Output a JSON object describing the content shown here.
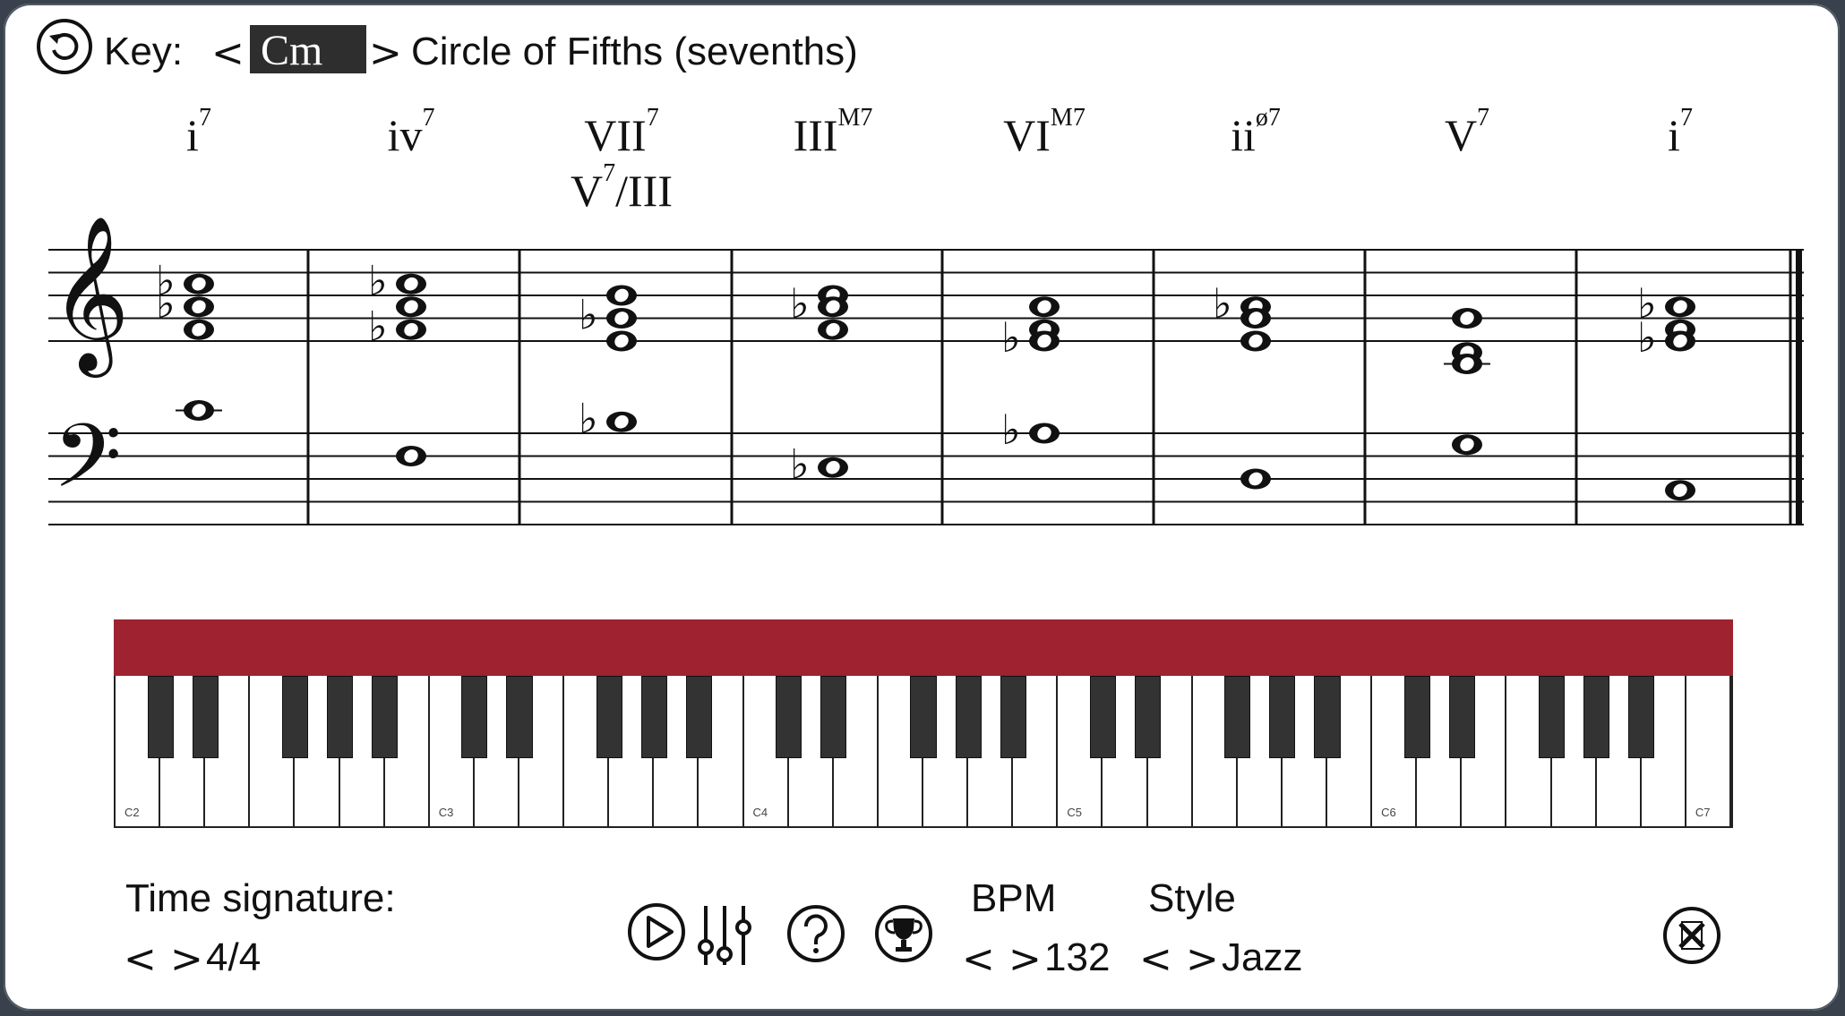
{
  "header": {
    "reset_icon": "reset-icon",
    "key_label": "Key:",
    "key_prev": "<",
    "key_value": "Cm",
    "key_next": ">",
    "progression_title": "Circle of Fifths (sevenths)"
  },
  "chords": [
    {
      "base": "i",
      "sup": "7",
      "alt_base": "",
      "alt_sup": "",
      "alt_tail": ""
    },
    {
      "base": "iv",
      "sup": "7",
      "alt_base": "",
      "alt_sup": "",
      "alt_tail": ""
    },
    {
      "base": "VII",
      "sup": "7",
      "alt_base": "V",
      "alt_sup": "7",
      "alt_tail": "/III"
    },
    {
      "base": "III",
      "sup": "M7",
      "alt_base": "",
      "alt_sup": "",
      "alt_tail": ""
    },
    {
      "base": "VI",
      "sup": "M7",
      "alt_base": "",
      "alt_sup": "",
      "alt_tail": ""
    },
    {
      "base": "ii",
      "sup": "ø7",
      "alt_base": "",
      "alt_sup": "",
      "alt_tail": ""
    },
    {
      "base": "V",
      "sup": "7",
      "alt_base": "",
      "alt_sup": "",
      "alt_tail": ""
    },
    {
      "base": "i",
      "sup": "7",
      "alt_base": "",
      "alt_sup": "",
      "alt_tail": ""
    }
  ],
  "notation": {
    "measures": [
      {
        "treble": [
          {
            "n": "C5",
            "acc": "♭"
          },
          {
            "n": "A4",
            "acc": "♭"
          },
          {
            "n": "F4",
            "acc": ""
          }
        ],
        "bass": [
          {
            "n": "C4",
            "acc": ""
          }
        ]
      },
      {
        "treble": [
          {
            "n": "C5",
            "acc": "♭"
          },
          {
            "n": "A4",
            "acc": ""
          },
          {
            "n": "F4",
            "acc": "♭"
          }
        ],
        "bass": [
          {
            "n": "F3",
            "acc": ""
          }
        ]
      },
      {
        "treble": [
          {
            "n": "B4",
            "acc": ""
          },
          {
            "n": "G4",
            "acc": "♭"
          },
          {
            "n": "E4",
            "acc": ""
          }
        ],
        "bass": [
          {
            "n": "B3",
            "acc": "♭"
          }
        ]
      },
      {
        "treble": [
          {
            "n": "B4",
            "acc": ""
          },
          {
            "n": "A4",
            "acc": "♭"
          },
          {
            "n": "F4",
            "acc": ""
          }
        ],
        "bass": [
          {
            "n": "E3",
            "acc": "♭"
          }
        ]
      },
      {
        "treble": [
          {
            "n": "A4",
            "acc": ""
          },
          {
            "n": "F4",
            "acc": ""
          },
          {
            "n": "E4",
            "acc": "♭"
          }
        ],
        "bass": [
          {
            "n": "A3",
            "acc": "♭"
          }
        ]
      },
      {
        "treble": [
          {
            "n": "A4",
            "acc": "♭"
          },
          {
            "n": "G4",
            "acc": ""
          },
          {
            "n": "E4",
            "acc": ""
          }
        ],
        "bass": [
          {
            "n": "D3",
            "acc": ""
          }
        ]
      },
      {
        "treble": [
          {
            "n": "G4",
            "acc": ""
          },
          {
            "n": "D4",
            "acc": ""
          },
          {
            "n": "C4",
            "acc": ""
          }
        ],
        "bass": [
          {
            "n": "G3",
            "acc": ""
          }
        ]
      },
      {
        "treble": [
          {
            "n": "A4",
            "acc": "♭"
          },
          {
            "n": "F4",
            "acc": ""
          },
          {
            "n": "E4",
            "acc": "♭"
          }
        ],
        "bass": [
          {
            "n": "C3",
            "acc": ""
          }
        ]
      }
    ]
  },
  "keyboard": {
    "lid_color": "#9e2230",
    "labels": [
      "C2",
      "C3",
      "C4",
      "C5",
      "C6",
      "C7"
    ]
  },
  "controls": {
    "time_signature_label": "Time signature:",
    "time_prev": "<",
    "time_next": ">",
    "time_value": "4/4",
    "play_icon": "play-icon",
    "mixer_icon": "mixer-icon",
    "help_icon": "help-icon",
    "trophy_icon": "trophy-icon",
    "bpm_label": "BPM",
    "bpm_prev": "<",
    "bpm_next": ">",
    "bpm_value": "132",
    "style_label": "Style",
    "style_prev": "<",
    "style_next": ">",
    "style_value": "Jazz",
    "close_icon": "close-icon"
  }
}
